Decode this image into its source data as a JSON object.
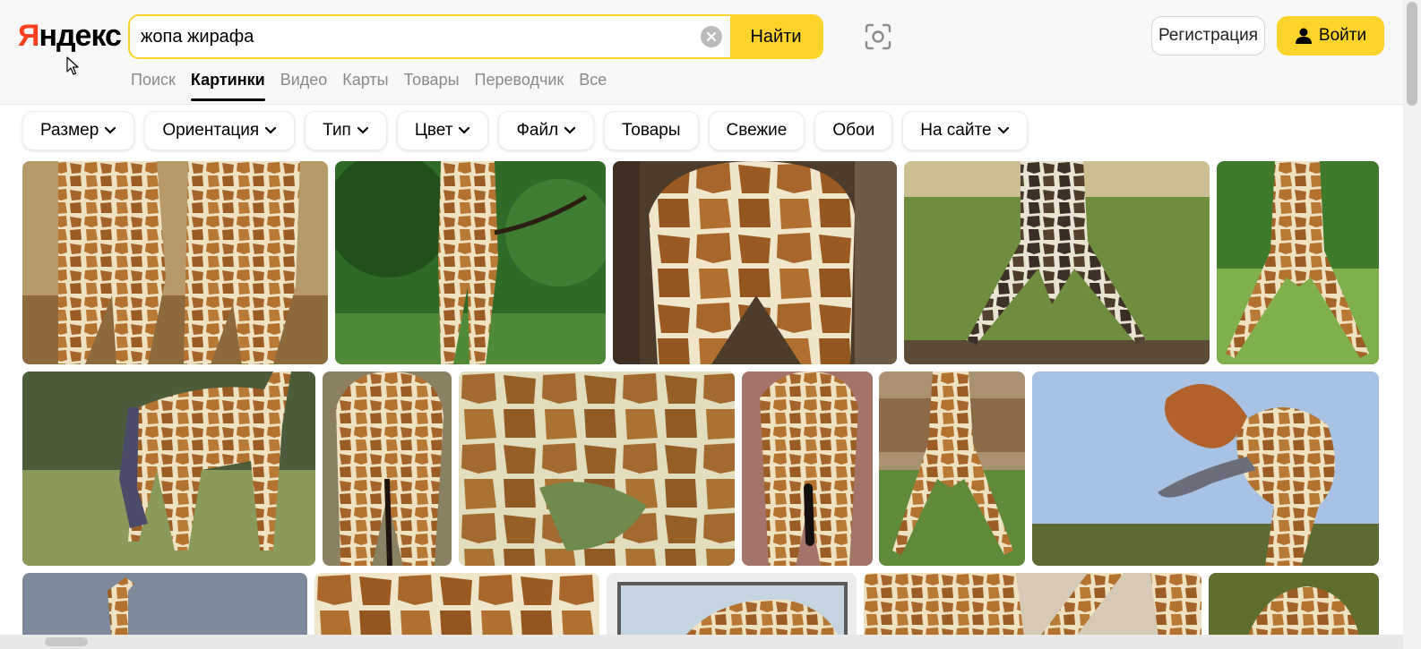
{
  "logo": {
    "first_letter": "Я",
    "rest": "ндекс"
  },
  "search": {
    "value": "жопа жирафа",
    "find_label": "Найти"
  },
  "header": {
    "register_label": "Регистрация",
    "login_label": "Войти"
  },
  "tabs": [
    {
      "label": "Поиск"
    },
    {
      "label": "Картинки",
      "active": true
    },
    {
      "label": "Видео"
    },
    {
      "label": "Карты"
    },
    {
      "label": "Товары"
    },
    {
      "label": "Переводчик"
    },
    {
      "label": "Все"
    }
  ],
  "filters": [
    {
      "label": "Размер",
      "dropdown": true
    },
    {
      "label": "Ориентация",
      "dropdown": true
    },
    {
      "label": "Тип",
      "dropdown": true
    },
    {
      "label": "Цвет",
      "dropdown": true
    },
    {
      "label": "Файл",
      "dropdown": true
    },
    {
      "label": "Товары",
      "dropdown": false
    },
    {
      "label": "Свежие",
      "dropdown": false
    },
    {
      "label": "Обои",
      "dropdown": false
    },
    {
      "label": "На сайте",
      "dropdown": true
    }
  ],
  "results": {
    "rows": [
      [
        "giraffe-pair-rear",
        "giraffe-forest-tail",
        "giraffe-close-rear-wood",
        "giraffe-drinking-splay",
        "giraffe-splay-lawn"
      ],
      [
        "giraffe-walking-savanna",
        "giraffe-rear-tail",
        "giraffe-belly-closeup",
        "giraffe-rear-rock",
        "giraffe-grazing-zoo",
        "giraffe-tongue-out"
      ],
      [
        "giraffe-sky-neck",
        "giraffe-pattern",
        "giraffe-framed",
        "giraffe-pair-trees",
        "giraffe-head-closeup"
      ]
    ]
  },
  "colors": {
    "accent": "#fed42b",
    "brand_red": "#fc3f1d"
  }
}
